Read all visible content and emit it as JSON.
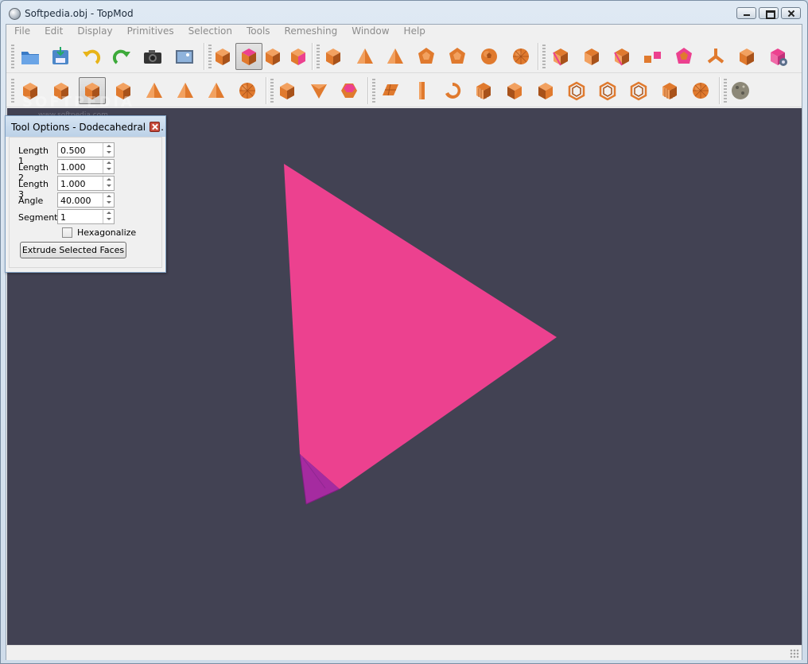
{
  "window": {
    "title": "Softpedia.obj - TopMod"
  },
  "menu": [
    "File",
    "Edit",
    "Display",
    "Primitives",
    "Selection",
    "Tools",
    "Remeshing",
    "Window",
    "Help"
  ],
  "toolbar1": [
    {
      "icon": "open-folder-icon"
    },
    {
      "icon": "save-icon"
    },
    {
      "icon": "undo-icon"
    },
    {
      "icon": "redo-icon"
    },
    {
      "icon": "camera-icon"
    },
    {
      "icon": "screenshot-icon"
    },
    {
      "icon": "vertex-select-icon"
    },
    {
      "icon": "face-select-icon"
    },
    {
      "icon": "edge-select-icon"
    },
    {
      "icon": "corner-select-icon"
    },
    {
      "icon": "cube-icon"
    },
    {
      "icon": "tetrahedron-icon"
    },
    {
      "icon": "pyramid-icon"
    },
    {
      "icon": "dodecahedron-icon"
    },
    {
      "icon": "icosahedron-icon"
    },
    {
      "icon": "soccerball-icon"
    },
    {
      "icon": "geodesic-icon"
    },
    {
      "icon": "insert-edge-icon"
    },
    {
      "icon": "delete-edge-icon"
    },
    {
      "icon": "collapse-edge-icon"
    },
    {
      "icon": "subdivide-edge-icon"
    },
    {
      "icon": "connect-edges-icon"
    },
    {
      "icon": "splice-corners-icon"
    },
    {
      "icon": "transforms-icon"
    },
    {
      "icon": "settings-icon"
    }
  ],
  "toolbar2": [
    {
      "icon": "cubical-extrude-icon"
    },
    {
      "icon": "doo-sabin-extrude-icon"
    },
    {
      "icon": "dodecahedral-extrude-icon"
    },
    {
      "icon": "icosahedral-extrude-icon"
    },
    {
      "icon": "octahedral-extrude-icon"
    },
    {
      "icon": "stellate-extrude-icon"
    },
    {
      "icon": "double-stellate-icon"
    },
    {
      "icon": "dome-extrude-icon"
    },
    {
      "icon": "conical-icon"
    },
    {
      "icon": "convex-hull-icon"
    },
    {
      "icon": "multiface-icon"
    },
    {
      "icon": "wireframe-icon"
    },
    {
      "icon": "column-icon"
    },
    {
      "icon": "sierpinski-icon"
    },
    {
      "icon": "menger-icon"
    },
    {
      "icon": "rind-icon"
    },
    {
      "icon": "crust-icon"
    },
    {
      "icon": "wireframe-modeling-icon"
    },
    {
      "icon": "hole-icon"
    },
    {
      "icon": "lattice-icon"
    },
    {
      "icon": "grid-icon"
    },
    {
      "icon": "sculpt-icon"
    },
    {
      "icon": "texture-icon"
    }
  ],
  "watermark": {
    "text": "SOFTPEDIA",
    "sub": "www.softpedia.com"
  },
  "toolOptions": {
    "title": "Tool Options - Dodecahedral E...",
    "fields": [
      {
        "label": "Length 1",
        "value": "0.500"
      },
      {
        "label": "Length 2",
        "value": "1.000"
      },
      {
        "label": "Length 3",
        "value": "1.000"
      },
      {
        "label": "Angle",
        "value": "40.000"
      },
      {
        "label": "Segments",
        "value": "1"
      }
    ],
    "checkbox": {
      "label": "Hexagonalize",
      "checked": false
    },
    "button": "Extrude Selected Faces"
  },
  "colors": {
    "viewport": "#424253",
    "face": "#ec418f",
    "faceShade": "#a52ba0",
    "orange": "#e07a2e"
  }
}
